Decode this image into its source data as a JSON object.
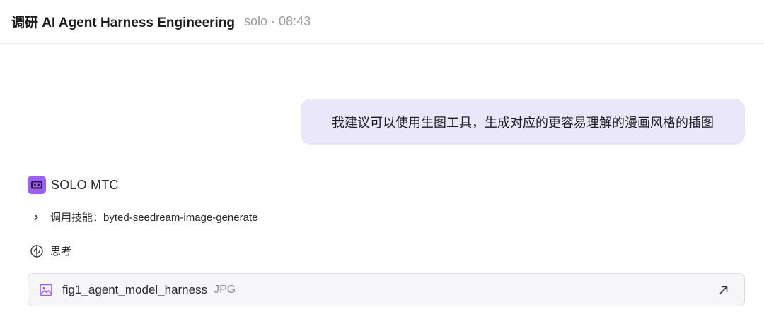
{
  "header": {
    "title": "调研 AI Agent Harness Engineering",
    "mode": "solo",
    "separator": "·",
    "time": "08:43"
  },
  "user_message": {
    "text": "我建议可以使用生图工具，生成对应的更容易理解的漫画风格的插图"
  },
  "agent": {
    "name": "SOLO MTC",
    "avatar_icon": "robot-icon",
    "avatar_color": "#9b61ee"
  },
  "skill_call": {
    "label": "调用技能：byted-seedream-image-generate",
    "icon": "chevron-right-icon"
  },
  "thinking": {
    "label": "思考",
    "icon": "brain-icon"
  },
  "attachment": {
    "filename": "fig1_agent_model_harness",
    "type": "JPG",
    "icon": "image-icon",
    "action_icon": "open-external-arrow-icon"
  },
  "colors": {
    "accent": "#9b61ee",
    "bubble_bg": "#ebe7fb",
    "meta_text": "#9a9aa3"
  }
}
